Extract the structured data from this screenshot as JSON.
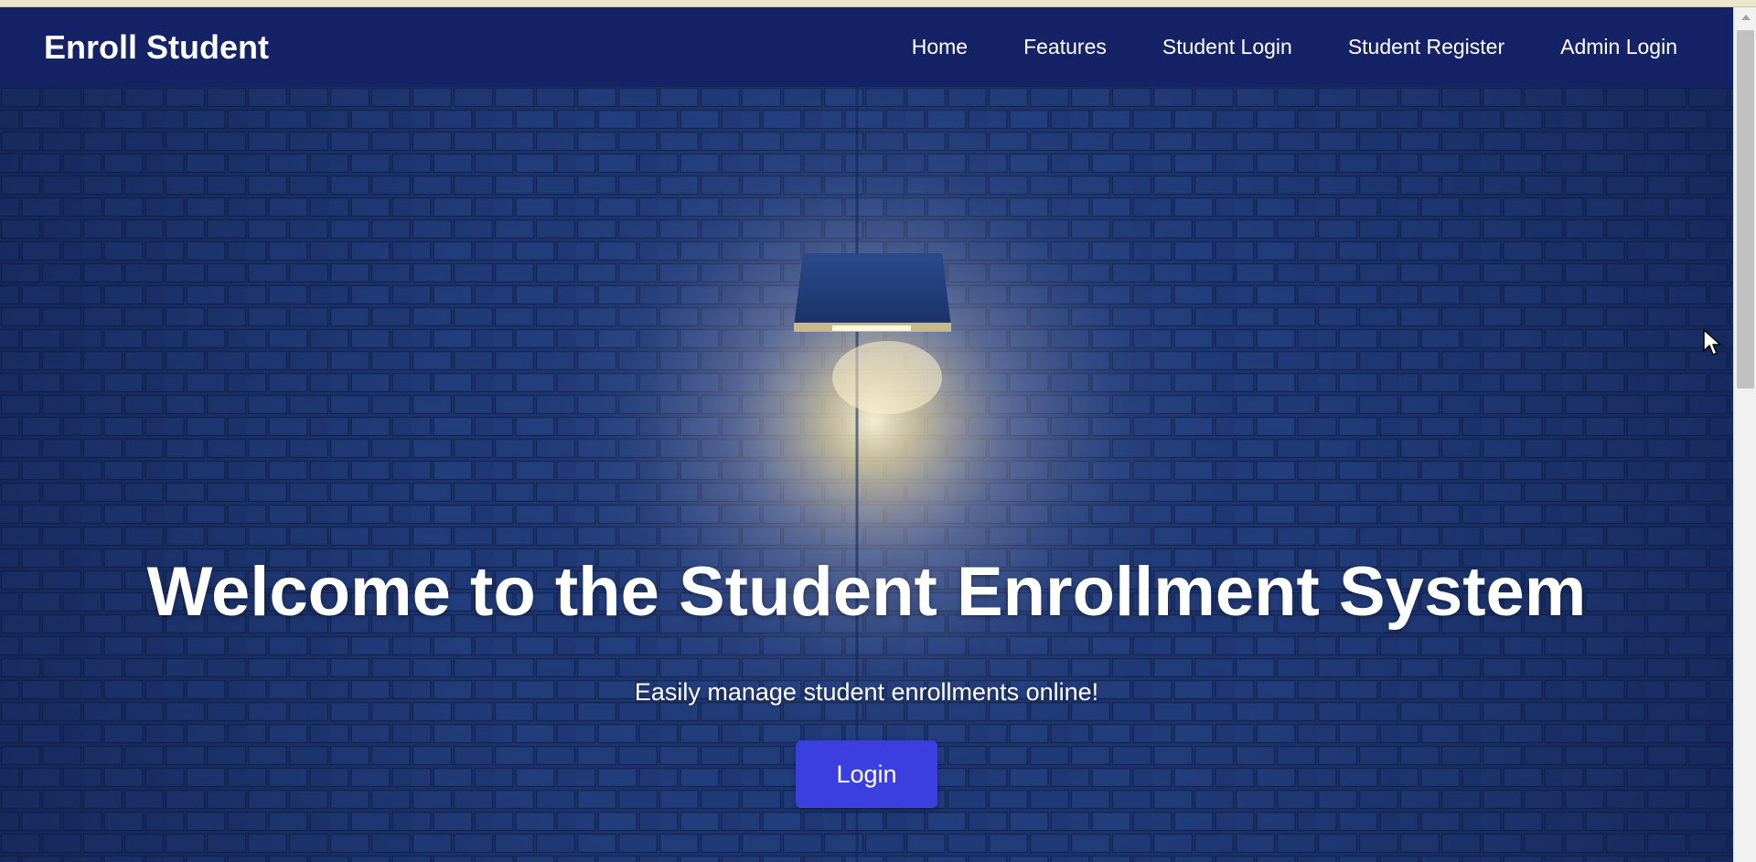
{
  "brand": "Enroll Student",
  "nav": {
    "home": "Home",
    "features": "Features",
    "student_login": "Student Login",
    "student_register": "Student Register",
    "admin_login": "Admin Login"
  },
  "hero": {
    "title": "Welcome to the Student Enrollment System",
    "subtitle": "Easily manage student enrollments online!",
    "login_label": "Login"
  },
  "colors": {
    "navbar": "#162266",
    "button": "#3c3fe0",
    "text": "#ffffff"
  },
  "icons": {
    "cursor": "mouse-pointer-icon",
    "scroll_up": "arrow-up-icon"
  }
}
